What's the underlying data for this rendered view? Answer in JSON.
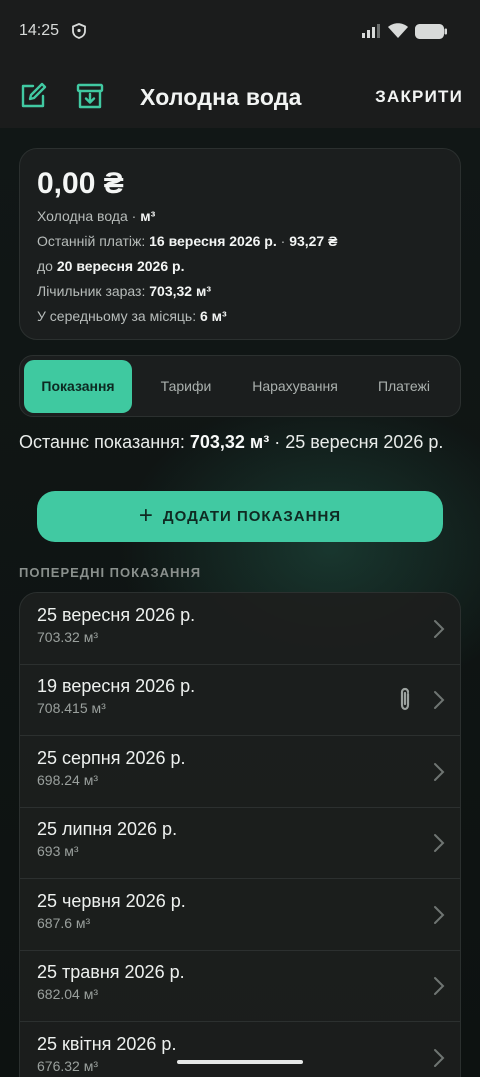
{
  "status_bar": {
    "time": "14:25"
  },
  "app_bar": {
    "title": "Холодна вода",
    "close_label": "ЗАКРИТИ"
  },
  "summary": {
    "amount": "0,00 ₴",
    "service": "Холодна вода",
    "unit": "м³",
    "last_payment_label": "Останній платіж:",
    "last_payment_date": "16 вересня 2026 р.",
    "last_payment_amount": "93,27 ₴",
    "until_label": "до",
    "until_date": "20 вересня 2026 р.",
    "meter_label": "Лічильник зараз:",
    "meter_value": "703,32 м³",
    "average_label": "У середньому за місяць:",
    "average_value": "6 м³"
  },
  "tabs": [
    {
      "label": "Показання",
      "active": true
    },
    {
      "label": "Тарифи",
      "active": false
    },
    {
      "label": "Нарахування",
      "active": false
    },
    {
      "label": "Платежі",
      "active": false
    }
  ],
  "last_reading": {
    "label": "Останнє показання:",
    "value": "703,32 м³",
    "date": "25 вересня 2026 р."
  },
  "add_button": {
    "label": "ДОДАТИ ПОКАЗАННЯ"
  },
  "history": {
    "title": "ПОПЕРЕДНІ ПОКАЗАННЯ",
    "items": [
      {
        "date": "25 вересня 2026 р.",
        "value": "703.32 м³",
        "attachment": false
      },
      {
        "date": "19 вересня 2026 р.",
        "value": "708.415 м³",
        "attachment": true
      },
      {
        "date": "25 серпня 2026 р.",
        "value": "698.24 м³",
        "attachment": false
      },
      {
        "date": "25 липня 2026 р.",
        "value": "693 м³",
        "attachment": false
      },
      {
        "date": "25 червня 2026 р.",
        "value": "687.6 м³",
        "attachment": false
      },
      {
        "date": "25 травня 2026 р.",
        "value": "682.04 м³",
        "attachment": false
      },
      {
        "date": "25 квітня 2026 р.",
        "value": "676.32 м³",
        "attachment": false
      }
    ]
  },
  "colors": {
    "accent": "#41c9a2",
    "background": "#0e1312",
    "card": "#1c201f"
  }
}
